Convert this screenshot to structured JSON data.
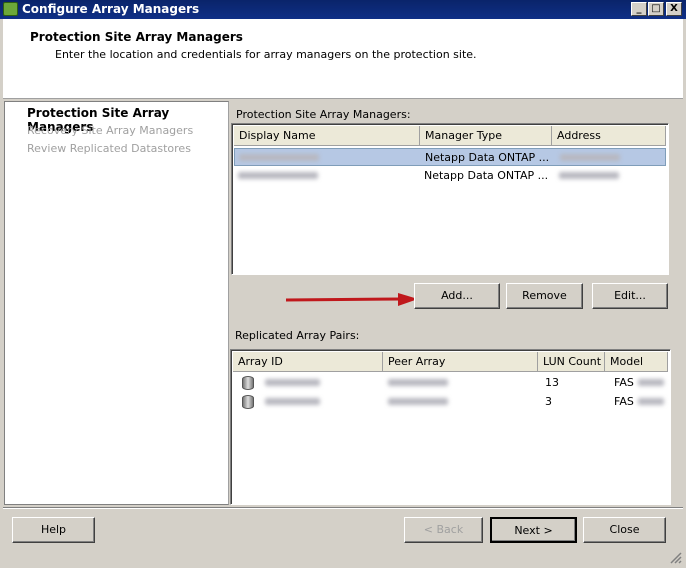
{
  "window": {
    "title": "Configure Array Managers",
    "min": "_",
    "max": "□",
    "close": "X"
  },
  "header": {
    "title": "Protection Site Array Managers",
    "subtitle": "Enter the location and credentials for array managers on the protection site."
  },
  "steps": [
    {
      "label": "Protection Site Array Managers"
    },
    {
      "label": "Recovery Site Array Managers"
    },
    {
      "label": "Review Replicated Datastores"
    }
  ],
  "managers": {
    "label": "Protection Site Array Managers:",
    "columns": [
      "Display Name",
      "Manager Type",
      "Address"
    ],
    "rows": [
      {
        "type": "Netapp Data ONTAP ...",
        "selected": true
      },
      {
        "type": "Netapp Data ONTAP ..."
      }
    ]
  },
  "actions": {
    "add": "Add...",
    "remove": "Remove",
    "edit": "Edit..."
  },
  "pairs": {
    "label": "Replicated Array Pairs:",
    "columns": [
      "Array ID",
      "Peer Array",
      "LUN Count",
      "Model"
    ],
    "rows": [
      {
        "lun_count": "13",
        "model": "FAS"
      },
      {
        "lun_count": "3",
        "model": "FAS"
      }
    ]
  },
  "footer": {
    "help": "Help",
    "back": "< Back",
    "next": "Next >",
    "close": "Close"
  },
  "colors": {
    "arrow": "#c0181c",
    "titlebar": "#0a246a"
  }
}
